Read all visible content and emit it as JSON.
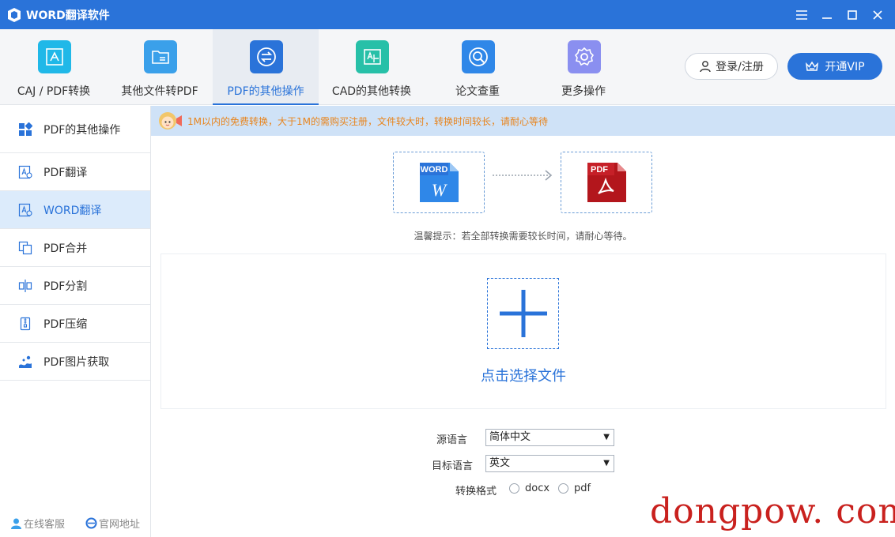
{
  "app": {
    "title": "WORD翻译软件"
  },
  "toolbar": {
    "tools": [
      {
        "label": "CAJ / PDF转换",
        "icon": "pdf-convert-icon",
        "color": "#20b8e8"
      },
      {
        "label": "其他文件转PDF",
        "icon": "folder-icon",
        "color": "#3aa0ea"
      },
      {
        "label": "PDF的其他操作",
        "icon": "exchange-icon",
        "color": "#2a73d9"
      },
      {
        "label": "CAD的其他转换",
        "icon": "cad-icon",
        "color": "#27c0a8"
      },
      {
        "label": "论文查重",
        "icon": "search-circle-icon",
        "color": "#2f87e8"
      },
      {
        "label": "更多操作",
        "icon": "gear-icon",
        "color": "#8a8ff0"
      }
    ],
    "active_index": 2,
    "login_label": "登录/注册",
    "vip_label": "开通VIP"
  },
  "sidebar": {
    "items": [
      {
        "label": "PDF的其他操作",
        "icon": "grid-icon"
      },
      {
        "label": "PDF翻译",
        "icon": "translate-doc-icon"
      },
      {
        "label": "WORD翻译",
        "icon": "translate-doc-icon"
      },
      {
        "label": "PDF合并",
        "icon": "merge-icon"
      },
      {
        "label": "PDF分割",
        "icon": "split-icon"
      },
      {
        "label": "PDF压缩",
        "icon": "compress-icon"
      },
      {
        "label": "PDF图片获取",
        "icon": "image-extract-icon"
      }
    ],
    "active_index": 2,
    "footer": {
      "service": "在线客服",
      "website": "官网地址"
    }
  },
  "main": {
    "notice": "1M以内的免费转换，大于1M的需购买注册，文件较大时，转换时间较长，请耐心等待",
    "from_badge": "WORD",
    "to_badge": "PDF",
    "hint": "温馨提示：若全部转换需要较长时间，请耐心等待。",
    "select_file": "点击选择文件",
    "source_lang_label": "源语言",
    "source_lang_value": "简体中文",
    "target_lang_label": "目标语言",
    "target_lang_value": "英文",
    "format_label": "转换格式",
    "format_options": [
      "docx",
      "pdf"
    ]
  },
  "watermark": "dongpow. com",
  "colors": {
    "accent": "#2a73d9",
    "notice_text": "#e8841c",
    "watermark": "#c9211e"
  }
}
